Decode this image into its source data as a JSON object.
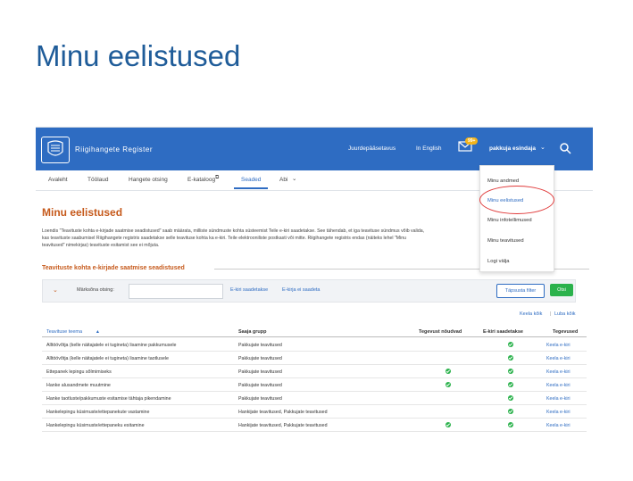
{
  "slide": {
    "title": "Minu eelistused"
  },
  "app": {
    "logo_text": "Riigihangete Register",
    "top_links": {
      "accessibility": "Juurdepääsetavus",
      "english": "In English"
    },
    "mail_badge": "99+",
    "user": "pakkuja esindaja"
  },
  "nav": [
    "Avaleht",
    "Töölaud",
    "Hangete otsing",
    "E-kataloog",
    "Seaded",
    "Abi"
  ],
  "dropdown": [
    "Minu andmed",
    "Minu eelistused",
    "Minu infotellimused",
    "Minu teavitused",
    "Logi välja"
  ],
  "page": {
    "title": "Minu eelistused",
    "description": [
      "Loendis \"Teavituste kohta e-kirjade saatmise seadistused\" saab määrata, milliste sündmuste kohta süsteemist Teile e-kiri saadetakse. See tähendab, et iga teavituse sündmus võib valida,",
      "kas teavituste saabumisel Riigihangete registris saadetakse selle teavituse kohta ka e-kiri. Teile elektrooniliste postkasti või mitte. Riigihangete registris endas (näiteks lehel \"Minu",
      "teavitused\" nimekirjas) teavituste esitamist see ei mõjuta."
    ],
    "section_title": "Teavituste kohta e-kirjade saatmise seadistused"
  },
  "filter": {
    "label": "Märksõna otsing:",
    "input_value": "",
    "link_send": "E-kiri saadetakse",
    "link_nosend": "E-kirja ei saadeta",
    "refine": "Täpsusta filter",
    "search": "Otsi"
  },
  "actions": {
    "forbid_all": "Keela kõik",
    "allow_all": "Luba kõik"
  },
  "table": {
    "headers": [
      "Teavituse teema",
      "Saaja grupp",
      "Tegevust nõudvad",
      "E-kiri saadetakse",
      "Tegevused"
    ],
    "rows": [
      {
        "topic": "Alltöövõtja (kelle näitajatele ei tugineta) lisamine pakkumusele",
        "group": "Pakkujate teavitused",
        "action_required": false,
        "email_sent": true,
        "action": "Keela e-kiri"
      },
      {
        "topic": "Alltöövõtja (kelle näitajatele ei tugineta) lisamine taotlusele",
        "group": "Pakkujate teavitused",
        "action_required": false,
        "email_sent": true,
        "action": "Keela e-kiri"
      },
      {
        "topic": "Ettepanek lepingu sõlmimiseks",
        "group": "Pakkujate teavitused",
        "action_required": true,
        "email_sent": true,
        "action": "Keela e-kiri"
      },
      {
        "topic": "Hanke alusandmete muutmine",
        "group": "Pakkujate teavitused",
        "action_required": true,
        "email_sent": true,
        "action": "Keela e-kiri"
      },
      {
        "topic": "Hanke taotluste/pakkumuste esitamise tähtaja pikendamine",
        "group": "Pakkujate teavitused",
        "action_required": false,
        "email_sent": true,
        "action": "Keela e-kiri"
      },
      {
        "topic": "Hankelepingu küsimuste/ettepanekute vastamine",
        "group": "Hankijate teavitused, Pakkujate teavitused",
        "action_required": false,
        "email_sent": true,
        "action": "Keela e-kiri"
      },
      {
        "topic": "Hankelepingu küsimuste/ettepaneku esitamine",
        "group": "Hankijate teavitused, Pakkujate teavitused",
        "action_required": true,
        "email_sent": true,
        "action": "Keela e-kiri"
      }
    ]
  },
  "colors": {
    "brand_blue": "#2e6cc2",
    "heading_orange": "#c65a1c",
    "success_green": "#2bb24c",
    "highlight_red": "#e03a3a"
  }
}
